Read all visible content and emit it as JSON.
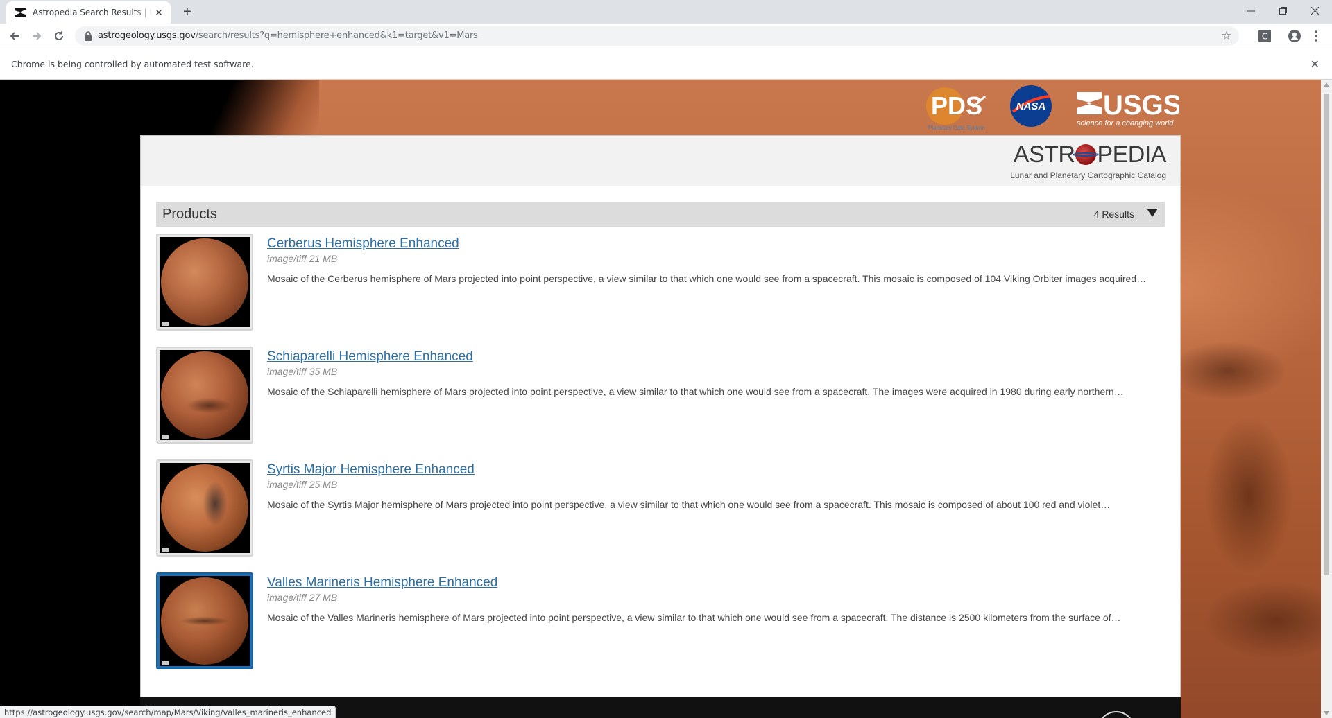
{
  "browser": {
    "tab_title": "Astropedia Search Results | USGS Astrogeology",
    "url_host": "astrogeology.usgs.gov",
    "url_path": "/search/results?q=hemisphere+enhanced&k1=target&v1=Mars",
    "infobar_text": "Chrome is being controlled by automated test software.",
    "status_url": "https://astrogeology.usgs.gov/search/map/Mars/Viking/valles_marineris_enhanced"
  },
  "header": {
    "logos": [
      "pds-logo",
      "nasa-logo",
      "usgs-logo"
    ],
    "pds_text": "PDS",
    "pds_sub": "Planetary Data System",
    "nasa_text": "NASA",
    "usgs_text": "USGS",
    "usgs_tagline": "science for a changing world",
    "astro_title_a": "ASTR",
    "astro_title_b": "PEDIA",
    "astro_subtitle": "Lunar and Planetary Cartographic Catalog"
  },
  "products": {
    "title": "Products",
    "count_label": "4 Results",
    "items": [
      {
        "title": "Cerberus Hemisphere Enhanced",
        "meta": "image/tiff 21 MB",
        "description": "Mosaic of the Cerberus hemisphere of Mars projected into point perspective, a view similar to that which one would see from a spacecraft. This mosaic is composed of 104 Viking Orbiter images acquired…",
        "selected": false
      },
      {
        "title": "Schiaparelli Hemisphere Enhanced",
        "meta": "image/tiff 35 MB",
        "description": "Mosaic of the Schiaparelli hemisphere of Mars projected into point perspective, a view similar to that which one would see from a spacecraft. The images were acquired in 1980 during early northern…",
        "selected": false
      },
      {
        "title": "Syrtis Major Hemisphere Enhanced",
        "meta": "image/tiff 25 MB",
        "description": "Mosaic of the Syrtis Major hemisphere of Mars projected into point perspective, a view similar to that which one would see from a spacecraft. This mosaic is composed of about 100 red and violet…",
        "selected": false
      },
      {
        "title": "Valles Marineris Hemisphere Enhanced",
        "meta": "image/tiff 27 MB",
        "description": "Mosaic of the Valles Marineris hemisphere of Mars projected into point perspective, a view similar to that which one would see from a spacecraft. The distance is 2500 kilometers from the surface of…",
        "selected": true
      }
    ]
  },
  "colors": {
    "link": "#2d6fa3",
    "selected_thumb": "#1f6fb2",
    "mars": "#b8663e"
  }
}
